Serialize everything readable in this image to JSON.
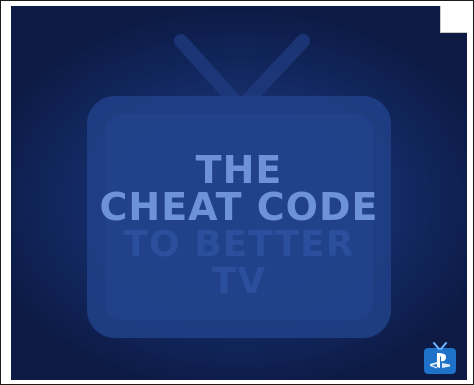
{
  "ad": {
    "headline": {
      "line1": "THE",
      "line2": "CHEAT CODE",
      "line3": "TO BETTER",
      "line4": "TV"
    },
    "icons": {
      "tv": "television-icon",
      "logo": "playstation-vue-logo-icon",
      "close": "close-box-icon"
    },
    "colors": {
      "background": "#112459",
      "tv_silhouette": "#203f85",
      "headline_bright": "#6d92d8",
      "headline_dim": "#2b4f9c",
      "logo_blue": "#1e73c8"
    }
  }
}
